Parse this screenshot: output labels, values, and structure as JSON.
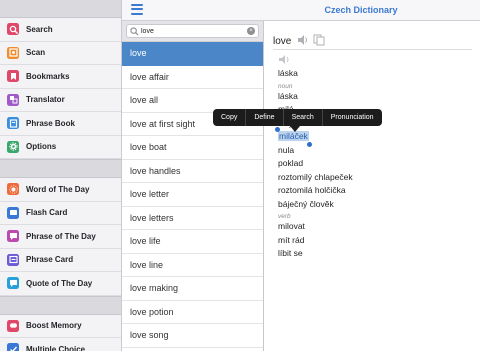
{
  "app": {
    "title": "Czech Dictionary"
  },
  "sidebar": {
    "group1": [
      {
        "label": "Search",
        "icon": "search-icon",
        "color": "#e0486a"
      },
      {
        "label": "Scan",
        "icon": "scan-icon",
        "color": "#f08c2b"
      },
      {
        "label": "Bookmarks",
        "icon": "bookmarks-icon",
        "color": "#e0486a"
      },
      {
        "label": "Translator",
        "icon": "translator-icon",
        "color": "#a05ac8"
      },
      {
        "label": "Phrase Book",
        "icon": "phrase-book-icon",
        "color": "#3a8ee0"
      },
      {
        "label": "Options",
        "icon": "gear-icon",
        "color": "#3aa76d"
      }
    ],
    "group2": [
      {
        "label": "Word of The Day",
        "icon": "sun-icon",
        "color": "#ef6a3a"
      },
      {
        "label": "Flash Card",
        "icon": "flash-card-icon",
        "color": "#3a78d8"
      },
      {
        "label": "Phrase of The Day",
        "icon": "chat-bubble-icon",
        "color": "#b84ab0"
      },
      {
        "label": "Phrase Card",
        "icon": "phrase-card-icon",
        "color": "#6b5bd4"
      },
      {
        "label": "Quote of The Day",
        "icon": "quote-icon",
        "color": "#2aa0d8"
      }
    ],
    "group3": [
      {
        "label": "Boost Memory",
        "icon": "brain-icon",
        "color": "#e0486a"
      },
      {
        "label": "Multiple Choice",
        "icon": "checklist-icon",
        "color": "#3a78d8"
      }
    ]
  },
  "search": {
    "value": "love",
    "placeholder": ""
  },
  "word_list": [
    "love",
    "love affair",
    "love all",
    "love at first sight",
    "love boat",
    "love handles",
    "love letter",
    "love letters",
    "love life",
    "love line",
    "love making",
    "love potion",
    "love song"
  ],
  "selected_index": 0,
  "detail": {
    "headword": "love",
    "groups": [
      {
        "pos": "",
        "translations": [
          "láska"
        ]
      },
      {
        "pos": "noun",
        "translations": [
          "láska",
          "milá",
          "milý",
          "miláček",
          "nula",
          "poklad",
          "roztomilý chlapeček",
          "roztomilá holčička",
          "báječný člověk"
        ]
      },
      {
        "pos": "verb",
        "translations": [
          "milovat",
          "mít rád",
          "líbit se"
        ]
      }
    ],
    "highlighted": "miláček"
  },
  "context_menu": [
    "Copy",
    "Define",
    "Search",
    "Pronunciation"
  ],
  "colors": {
    "accent": "#3b7ad1",
    "selection": "#4a86c8",
    "highlight": "#bcd3f0"
  }
}
